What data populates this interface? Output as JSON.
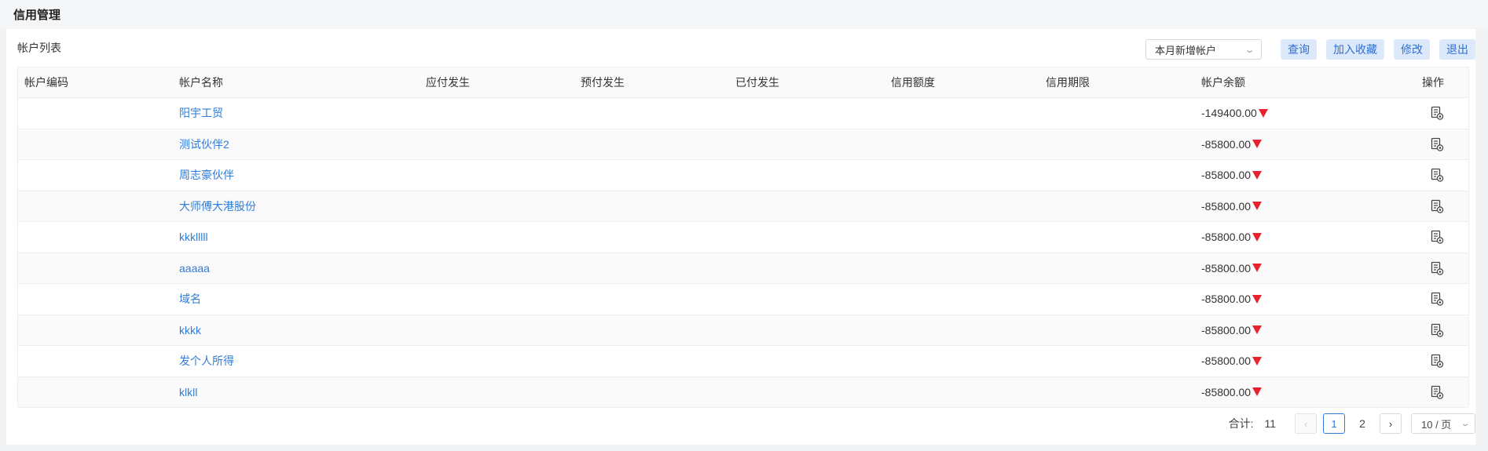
{
  "page": {
    "title": "信用管理"
  },
  "section": {
    "title": "帐户列表"
  },
  "toolbar": {
    "filter_value": "本月新增帐户",
    "query_label": "查询",
    "favorite_label": "加入收藏",
    "edit_label": "修改",
    "exit_label": "退出"
  },
  "table": {
    "columns": [
      "帐户编码",
      "帐户名称",
      "应付发生",
      "预付发生",
      "已付发生",
      "信用额度",
      "信用期限",
      "帐户余额",
      "操作"
    ],
    "rows": [
      {
        "code": "",
        "name": "阳宇工贸",
        "payable": "",
        "prepaid": "",
        "paid": "",
        "credit_limit": "",
        "credit_term": "",
        "balance": "-149400.00",
        "trend": "down"
      },
      {
        "code": "",
        "name": "测试伙伴2",
        "payable": "",
        "prepaid": "",
        "paid": "",
        "credit_limit": "",
        "credit_term": "",
        "balance": "-85800.00",
        "trend": "down"
      },
      {
        "code": "",
        "name": "周志豪伙伴",
        "payable": "",
        "prepaid": "",
        "paid": "",
        "credit_limit": "",
        "credit_term": "",
        "balance": "-85800.00",
        "trend": "down"
      },
      {
        "code": "",
        "name": "大师傅大港股份",
        "payable": "",
        "prepaid": "",
        "paid": "",
        "credit_limit": "",
        "credit_term": "",
        "balance": "-85800.00",
        "trend": "down"
      },
      {
        "code": "",
        "name": "kkklllll",
        "payable": "",
        "prepaid": "",
        "paid": "",
        "credit_limit": "",
        "credit_term": "",
        "balance": "-85800.00",
        "trend": "down"
      },
      {
        "code": "",
        "name": "aaaaa",
        "payable": "",
        "prepaid": "",
        "paid": "",
        "credit_limit": "",
        "credit_term": "",
        "balance": "-85800.00",
        "trend": "down"
      },
      {
        "code": "",
        "name": "域名",
        "payable": "",
        "prepaid": "",
        "paid": "",
        "credit_limit": "",
        "credit_term": "",
        "balance": "-85800.00",
        "trend": "down"
      },
      {
        "code": "",
        "name": "kkkk",
        "payable": "",
        "prepaid": "",
        "paid": "",
        "credit_limit": "",
        "credit_term": "",
        "balance": "-85800.00",
        "trend": "down"
      },
      {
        "code": "",
        "name": "发个人所得",
        "payable": "",
        "prepaid": "",
        "paid": "",
        "credit_limit": "",
        "credit_term": "",
        "balance": "-85800.00",
        "trend": "down"
      },
      {
        "code": "",
        "name": "klkll",
        "payable": "",
        "prepaid": "",
        "paid": "",
        "credit_limit": "",
        "credit_term": "",
        "balance": "-85800.00",
        "trend": "down"
      }
    ],
    "row_action_icon": "document-view-icon",
    "trend_icon": "down-triangle-icon",
    "trend_color": "#e8232f",
    "link_color": "#2f7cd8"
  },
  "pagination": {
    "total_label": "合计:",
    "total": "11",
    "pages": [
      "1",
      "2"
    ],
    "current_page": "1",
    "page_size": "10 / 页",
    "prev_icon": "chevron-left-icon",
    "next_icon": "chevron-right-icon"
  }
}
